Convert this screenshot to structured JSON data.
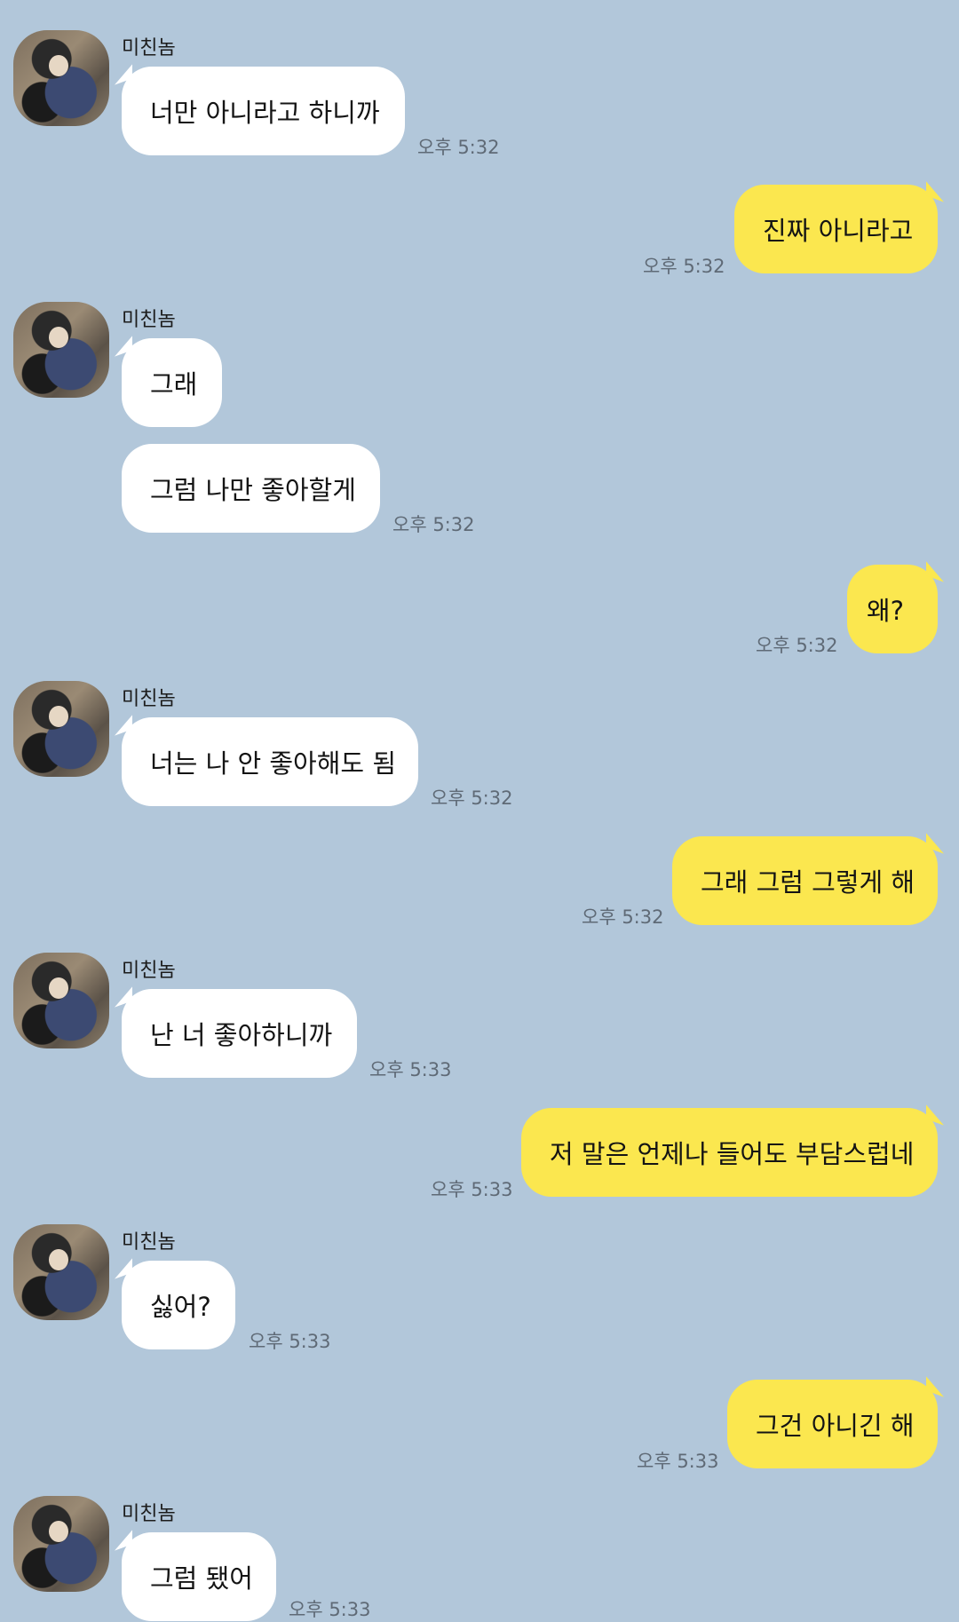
{
  "chat": {
    "sender_name": "미친놈",
    "messages": [
      {
        "from": "other",
        "text": "너만 아니라고 하니까",
        "time": "오후 5:32"
      },
      {
        "from": "me",
        "text": "진짜 아니라고",
        "time": "오후 5:32"
      },
      {
        "from": "other",
        "text": "그래",
        "time": ""
      },
      {
        "from": "other",
        "text": "그럼 나만 좋아할게",
        "time": "오후 5:32"
      },
      {
        "from": "me",
        "text": "왜?",
        "time": "오후 5:32"
      },
      {
        "from": "other",
        "text": "너는 나 안 좋아해도 됨",
        "time": "오후 5:32"
      },
      {
        "from": "me",
        "text": "그래 그럼 그렇게 해",
        "time": "오후 5:32"
      },
      {
        "from": "other",
        "text": "난 너 좋아하니까",
        "time": "오후 5:33"
      },
      {
        "from": "me",
        "text": "저 말은 언제나 들어도 부담스럽네",
        "time": "오후 5:33"
      },
      {
        "from": "other",
        "text": "싫어?",
        "time": "오후 5:33"
      },
      {
        "from": "me",
        "text": "그건 아니긴 해",
        "time": "오후 5:33"
      },
      {
        "from": "other",
        "text": "그럼 됐어",
        "time": "오후 5:33"
      }
    ]
  },
  "colors": {
    "background": "#b2c7da",
    "incoming_bubble": "#ffffff",
    "outgoing_bubble": "#fbe74f",
    "time_text": "#5f6a76"
  }
}
